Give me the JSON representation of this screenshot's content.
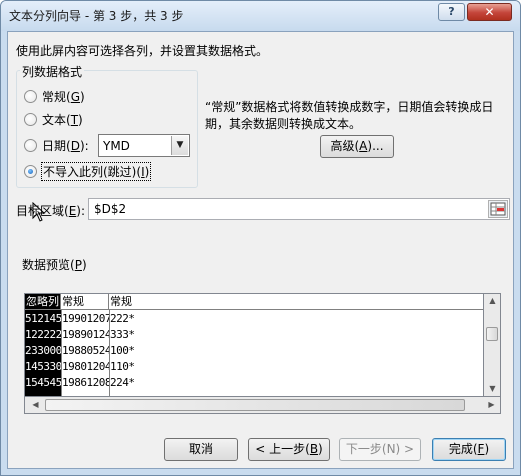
{
  "window": {
    "title": "文本分列向导 - 第 3 步，共 3 步",
    "help_label": "?",
    "close_label": "✕"
  },
  "instruction": "使用此屏内容可选择各列，并设置其数据格式。",
  "column_format": {
    "legend": "列数据格式",
    "options": [
      {
        "label": "常规",
        "hotkey": "G",
        "checked": false
      },
      {
        "label": "文本",
        "hotkey": "T",
        "checked": false
      },
      {
        "label": "日期",
        "hotkey": "D",
        "checked": false
      },
      {
        "label": "不导入此列(跳过)",
        "hotkey": "I",
        "checked": true
      }
    ],
    "date_format": "YMD"
  },
  "description": "“常规”数据格式将数值转换成数字，日期值会转换成日期，其余数据则转换成文本。",
  "advanced": {
    "label": "高级",
    "hotkey": "A"
  },
  "destination": {
    "label": "目标区域",
    "hotkey": "E",
    "value": "$D$2",
    "ref_icon": "range-picker-icon"
  },
  "preview": {
    "label": "数据预览",
    "hotkey": "P",
    "headers": [
      "忽略列",
      "常规",
      "常规"
    ],
    "rows": [
      [
        "512145",
        "19901207",
        "222*"
      ],
      [
        "122222",
        "19890124",
        "333*"
      ],
      [
        "233000",
        "19880524",
        "100*"
      ],
      [
        "145330",
        "19801204",
        "110*"
      ],
      [
        "154545",
        "19861208",
        "224*"
      ]
    ]
  },
  "buttons": {
    "cancel": "取消",
    "back": {
      "label": "< 上一步",
      "hotkey": "B"
    },
    "next": {
      "label": "下一步(N) >"
    },
    "finish": {
      "label": "完成",
      "hotkey": "F"
    }
  }
}
